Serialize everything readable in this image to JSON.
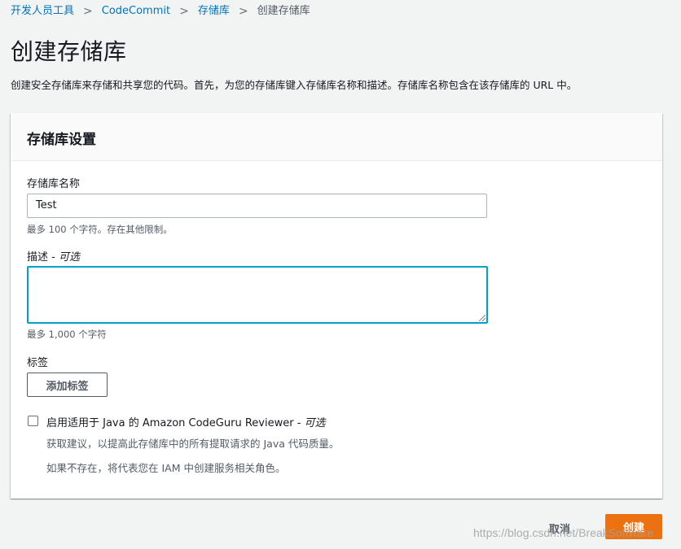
{
  "breadcrumb": {
    "items": [
      "开发人员工具",
      "CodeCommit",
      "存储库"
    ],
    "current": "创建存储库",
    "separator": ">"
  },
  "page": {
    "title": "创建存储库",
    "description": "创建安全存储库来存储和共享您的代码。首先，为您的存储库键入存储库名称和描述。存储库名称包含在该存储库的 URL 中。"
  },
  "panel": {
    "title": "存储库设置",
    "name_label": "存储库名称",
    "name_value": "Test",
    "name_hint": "最多 100 个字符。存在其他限制。",
    "desc_label": "描述 - ",
    "desc_optional": "可选",
    "desc_value": "",
    "desc_hint": "最多 1,000 个字符",
    "tags_label": "标签",
    "add_tag_button": "添加标签",
    "codeguru_label": "启用适用于 Java 的 Amazon CodeGuru Reviewer - ",
    "codeguru_optional": "可选",
    "codeguru_checked": false,
    "codeguru_desc1": "获取建议，以提高此存储库中的所有提取请求的 Java 代码质量。",
    "codeguru_desc2": "如果不存在，将代表您在 IAM 中创建服务相关角色。"
  },
  "footer": {
    "cancel_label": "取消",
    "create_label": "创建"
  },
  "watermark": "https://blog.csdn.net/BreakSoftware",
  "colors": {
    "link": "#0073bb",
    "primary": "#ec7211",
    "focus": "#00a1c9",
    "background": "#f2f3f3"
  }
}
